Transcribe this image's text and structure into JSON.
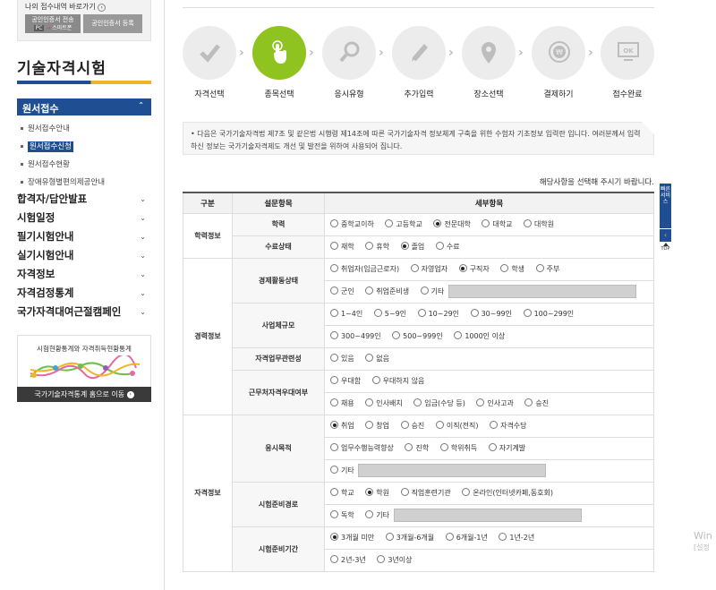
{
  "sidebar": {
    "my_apply_link": "나의 접수내역 바로가기",
    "cert_transfer": "공인인증서 전송",
    "cert_transfer_sub_pc": "PC",
    "cert_transfer_sub_arrow": "→",
    "cert_transfer_sub_phone": "스마트폰",
    "cert_register": "공인인증서 등록",
    "title": "기술자격시험",
    "active_menu": "원서접수",
    "submenu": [
      {
        "label": "원서접수안내",
        "active": false
      },
      {
        "label": "원서접수신청",
        "active": true
      },
      {
        "label": "원서접수현황",
        "active": false
      },
      {
        "label": "장애유형별편의제공안내",
        "active": false
      }
    ],
    "menu": [
      "합격자/답안발표",
      "시험일정",
      "필기시험안내",
      "실기시험안내",
      "자격정보",
      "자격검정통계",
      "국가자격대여근절캠페인"
    ],
    "stats_title": "시험현황통계와 자격취득현황통계",
    "stats_button": "국가기술자격통계 홈으로 이동"
  },
  "steps": [
    {
      "label": "자격선택",
      "icon": "check-icon",
      "active": false
    },
    {
      "label": "종목선택",
      "icon": "pointer-hand-icon",
      "active": true
    },
    {
      "label": "응시유형",
      "icon": "search-icon",
      "active": false
    },
    {
      "label": "추가입력",
      "icon": "pencil-icon",
      "active": false
    },
    {
      "label": "장소선택",
      "icon": "location-pin-icon",
      "active": false
    },
    {
      "label": "결제하기",
      "icon": "coin-icon",
      "active": false
    },
    {
      "label": "접수완료",
      "icon": "ok-monitor-icon",
      "active": false
    }
  ],
  "notice": "다음은 국가기술자격법 제7조 및 같은법 시행령 제14조에 따른 국가기술자격 정보체계 구축을 위한 수험자 기초정보 입력란 입니다. 여러분께서 입력하신 정보는 국가기술자격제도 개선 및 발전을 위하여 사용되어 집니다.",
  "hint": "해당사항을 선택해 주시기 바랍니다.",
  "table": {
    "headers": [
      "구분",
      "설문항목",
      "세부항목"
    ],
    "groups": {
      "g1": "학력정보",
      "g2": "경력정보",
      "g3": "자격정보"
    },
    "rows": {
      "education": {
        "q": "학력",
        "opts": [
          "중학교이하",
          "고등학교",
          "전문대학",
          "대학교",
          "대학원"
        ],
        "sel": 2
      },
      "status": {
        "q": "수료상태",
        "opts": [
          "재학",
          "휴학",
          "졸업",
          "수료"
        ],
        "sel": 2
      },
      "econ": {
        "q": "경제활동상태",
        "line1": [
          "취업자(임금근로자)",
          "자영업자",
          "구직자",
          "학생",
          "주부"
        ],
        "line2": [
          "군인",
          "취업준비생",
          "기타"
        ],
        "sel": 2
      },
      "size": {
        "q": "사업체규모",
        "line1": [
          "1~4인",
          "5~9인",
          "10~29인",
          "30~99인",
          "100~299인"
        ],
        "line2": [
          "300~499인",
          "500~999인",
          "1000인 이상"
        ]
      },
      "relevance": {
        "q": "자격업무관련성",
        "opts": [
          "있음",
          "없음"
        ]
      },
      "preference": {
        "q": "근무처자격우대여부",
        "line1": [
          "우대함",
          "우대하지 않음"
        ],
        "line2": [
          "채용",
          "인사배치",
          "임금(수당 등)",
          "인사고과",
          "승진"
        ]
      },
      "purpose": {
        "q": "응시목적",
        "line1": [
          "취업",
          "창업",
          "승진",
          "이직(전직)",
          "자격수당"
        ],
        "line2": [
          "업무수행능력향상",
          "진학",
          "학위취득",
          "자기계발"
        ],
        "line3": [
          "기타"
        ],
        "sel": 0
      },
      "path": {
        "q": "시험준비경로",
        "line1": [
          "학교",
          "학원",
          "직업훈련기관",
          "온라인(인터넷카페,동호회)"
        ],
        "line2": [
          "독학",
          "기타"
        ],
        "sel": 1
      },
      "period": {
        "q": "시험준비기간",
        "line1": [
          "3개월 미만",
          "3개월-6개월",
          "6개월-1년",
          "1년-2년"
        ],
        "line2": [
          "2년-3년",
          "3년이상"
        ],
        "sel": 0
      }
    }
  },
  "quickbar": {
    "service": "빠른서비스",
    "top": "TOP"
  },
  "watermark": {
    "line1": "Win",
    "line2": "[설정"
  }
}
